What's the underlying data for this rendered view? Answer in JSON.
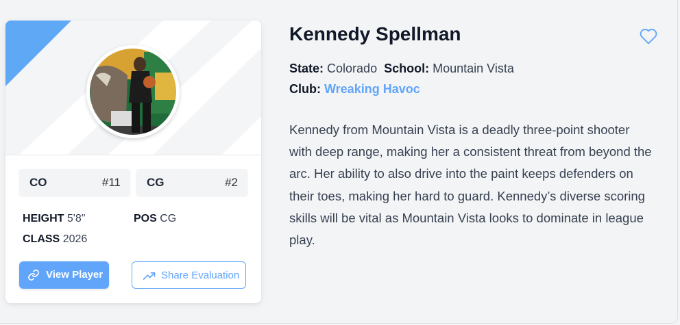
{
  "player": {
    "name": "Kennedy Spellman",
    "state_label": "State:",
    "state": "Colorado",
    "school_label": "School:",
    "school": "Mountain Vista",
    "club_label": "Club:",
    "club": "Wreaking Havoc",
    "bio": "Kennedy from Mountain Vista is a deadly three-point shooter with deep range, making her a consistent threat from beyond the arc. Her ability to also drive into the paint keeps defenders on their toes, making her hard to guard. Kennedy’s diverse scoring skills will be vital as Mountain Vista looks to dominate in league play."
  },
  "card": {
    "stats": [
      {
        "label": "CO",
        "value": "#11"
      },
      {
        "label": "CG",
        "value": "#2"
      }
    ],
    "height_label": "HEIGHT",
    "height": "5'8\"",
    "pos_label": "POS",
    "pos": "CG",
    "class_label": "CLASS",
    "class_year": "2026",
    "view_button": "View Player",
    "share_button": "Share Evaluation"
  },
  "icons": {
    "favorite": "heart-outline-icon",
    "view": "link-icon",
    "share": "trending-up-icon"
  },
  "colors": {
    "accent": "#60a5fa",
    "background": "#f3f4f6",
    "card": "#ffffff"
  }
}
